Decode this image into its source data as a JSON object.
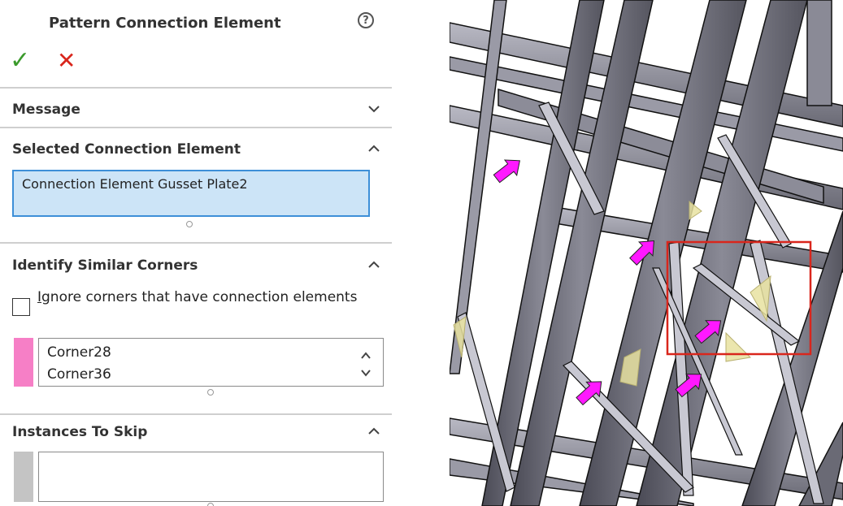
{
  "panel": {
    "title": "Pattern Connection Element",
    "help_glyph": "?",
    "ok_glyph": "✓",
    "cancel_glyph": "✕"
  },
  "sections": {
    "message": {
      "label": "Message",
      "expanded": false
    },
    "selected": {
      "label": "Selected Connection Element",
      "expanded": true,
      "value": "Connection Element Gusset Plate2",
      "box_color": "#cce4f7",
      "border_color": "#3d8fd8"
    },
    "identify": {
      "label": "Identify Similar Corners",
      "expanded": true,
      "checkbox_label_first": "I",
      "checkbox_label_rest": "gnore corners that have connection elements",
      "checkbox_checked": false,
      "swatch_color": "#f67fc6",
      "corners": [
        "Corner28",
        "Corner36"
      ]
    },
    "skip": {
      "label": "Instances To Skip",
      "expanded": true,
      "swatch_color": "#c4c4c4"
    }
  },
  "viewport": {
    "scene": "steel-frame-3d-model",
    "highlight_color": "#d9261c",
    "arrow_color": "#ff18ff",
    "gusset_color": "#e8e2a0",
    "member_color": "#6d6d78"
  }
}
